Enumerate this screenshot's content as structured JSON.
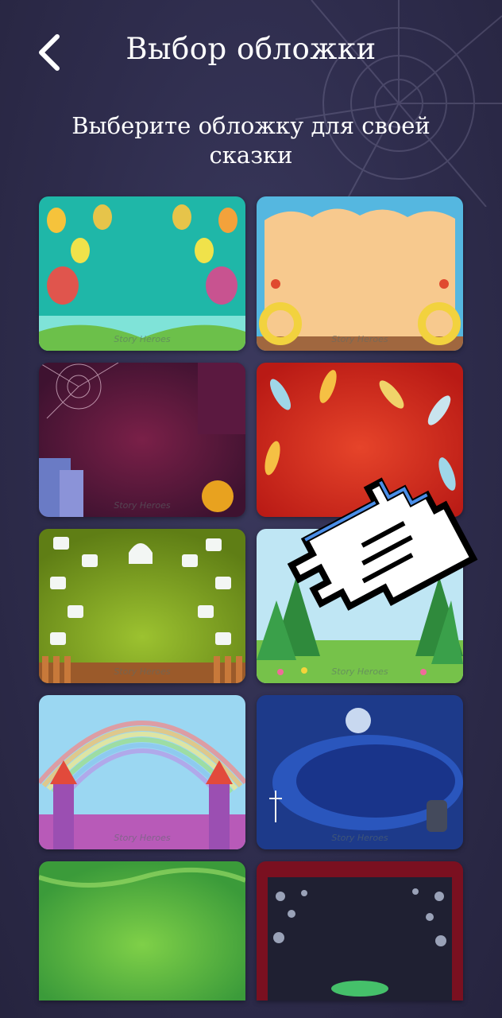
{
  "header": {
    "title": "Выбор обложки",
    "back_icon": "chevron-left-icon"
  },
  "subtitle": "Выберите обложку для своей сказки",
  "covers": [
    {
      "id": "balloons",
      "brand": "Story Heroes"
    },
    {
      "id": "beach",
      "brand": "Story Heroes"
    },
    {
      "id": "spooky",
      "brand": "Story Heroes"
    },
    {
      "id": "feathers",
      "brand": ""
    },
    {
      "id": "teacups",
      "brand": "Story Heroes"
    },
    {
      "id": "forest",
      "brand": "Story Heroes"
    },
    {
      "id": "rainbow-castle",
      "brand": "Story Heroes"
    },
    {
      "id": "night-skeletons",
      "brand": "Story Heroes"
    },
    {
      "id": "green-magic",
      "brand": ""
    },
    {
      "id": "theater-bubbles",
      "brand": ""
    }
  ],
  "colors": {
    "background": "#2e2c4c",
    "text": "#ffffff"
  },
  "overlay": {
    "icon": "pointing-hand-cursor-icon"
  }
}
